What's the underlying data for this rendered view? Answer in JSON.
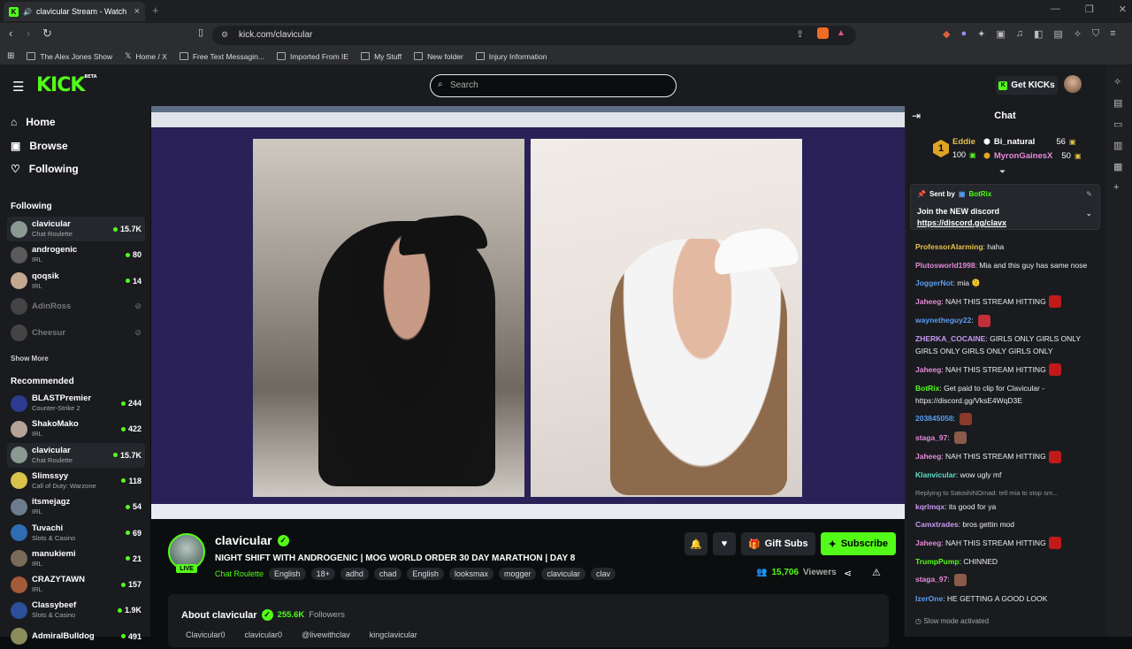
{
  "browser": {
    "tab_title": "clavicular Stream - Watch Live",
    "new_tab": "+",
    "url": "kick.com/clavicular",
    "window_controls": [
      "—",
      "❐",
      "✕"
    ],
    "bookmarks": [
      "The Alex Jones Show",
      "Home / X",
      "Free Text Messagin...",
      "Imported From IE",
      "My Stuff",
      "New folder",
      "Injury Information"
    ]
  },
  "header": {
    "logo": "KICK",
    "logo_tag": "BETA",
    "search_placeholder": "Search",
    "get_kicks": "Get KICKs"
  },
  "sidebar": {
    "nav": [
      {
        "icon": "home-icon",
        "label": "Home"
      },
      {
        "icon": "browse-icon",
        "label": "Browse"
      },
      {
        "icon": "heart-icon",
        "label": "Following"
      }
    ],
    "following_heading": "Following",
    "following": [
      {
        "name": "clavicular",
        "category": "Chat Roulette",
        "viewers": "15.7K",
        "live": true,
        "active": true,
        "color": "#8a9a93"
      },
      {
        "name": "androgenic",
        "category": "IRL",
        "viewers": "80",
        "live": true,
        "color": "#5a5a5a"
      },
      {
        "name": "qoqsik",
        "category": "IRL",
        "viewers": "14",
        "live": true,
        "color": "#c4a88f"
      },
      {
        "name": "AdinRoss",
        "category": "",
        "viewers": "",
        "live": false,
        "color": "#444"
      },
      {
        "name": "Cheesur",
        "category": "",
        "viewers": "",
        "live": false,
        "color": "#444"
      }
    ],
    "show_more": "Show More",
    "recommended_heading": "Recommended",
    "recommended": [
      {
        "name": "BLASTPremier",
        "category": "Counter-Strike 2",
        "viewers": "244",
        "color": "#2c3b8e"
      },
      {
        "name": "ShakoMako",
        "category": "IRL",
        "viewers": "422",
        "color": "#b5a397"
      },
      {
        "name": "clavicular",
        "category": "Chat Roulette",
        "viewers": "15.7K",
        "active": true,
        "color": "#8a9a93"
      },
      {
        "name": "Slimssyy",
        "category": "Call of Duty: Warzone",
        "viewers": "118",
        "color": "#d9c24a"
      },
      {
        "name": "itsmejagz",
        "category": "IRL",
        "viewers": "54",
        "color": "#6c7c8c"
      },
      {
        "name": "Tuvachi",
        "category": "Slots & Casino",
        "viewers": "69",
        "color": "#2f6db3"
      },
      {
        "name": "manukiemi",
        "category": "IRL",
        "viewers": "21",
        "color": "#7a6a5a"
      },
      {
        "name": "CRAZYTAWN",
        "category": "IRL",
        "viewers": "157",
        "color": "#a45a3a"
      },
      {
        "name": "Classybeef",
        "category": "Slots & Casino",
        "viewers": "1.9K",
        "color": "#2b4f9b"
      },
      {
        "name": "AdmiralBulldog",
        "category": "",
        "viewers": "491",
        "color": "#8c8c5c"
      }
    ]
  },
  "stream": {
    "channel": "clavicular",
    "live_label": "LIVE",
    "title": "NIGHT SHIFT WITH ANDROGENIC | MOG WORLD ORDER 30 DAY MARATHON | DAY 8",
    "category": "Chat Roulette",
    "tags": [
      "English",
      "18+",
      "adhd",
      "chad",
      "English",
      "looksmax",
      "mogger",
      "clavicular",
      "clav"
    ],
    "gift_subs": "Gift Subs",
    "subscribe": "Subscribe",
    "viewers": "15,706",
    "viewers_label": "Viewers",
    "about_title": "About clavicular",
    "followers": "255.6K",
    "followers_label": "Followers",
    "socials": [
      "Clavicular0",
      "clavicular0",
      "@livewithclav",
      "kingclavicular"
    ]
  },
  "chat": {
    "title": "Chat",
    "leaderboard": [
      {
        "name": "Eddie",
        "amount": "100",
        "rank": "1"
      },
      {
        "name": "Bi_natural",
        "amount": "56"
      },
      {
        "name": "MyronGainesX",
        "amount": "50"
      }
    ],
    "pinned": {
      "sent_by_label": "Sent by",
      "sender": "BotRix",
      "message": "Join the NEW discord",
      "link": "https://discord.gg/clavx"
    },
    "messages": [
      {
        "user": "ProfessorAlarming",
        "color": "#e7c14a",
        "text": "haha"
      },
      {
        "user": "Plutosworld1998",
        "color": "#e58ad8",
        "text": "Mia and this guy has same nose"
      },
      {
        "user": "JoggerNot",
        "color": "#5b9df0",
        "text": "mia 🫠"
      },
      {
        "user": "Jaheeg",
        "color": "#e58ad8",
        "text": "NAH THIS STREAM HITTING",
        "emote": "#c21a1a"
      },
      {
        "user": "waynetheguy22",
        "color": "#5b9df0",
        "text": "",
        "emote": "#c0303a"
      },
      {
        "user": "ZHERKA_COCAINE",
        "color": "#c89af0",
        "text": "GIRLS ONLY GIRLS ONLY GIRLS ONLY GIRLS ONLY GIRLS ONLY"
      },
      {
        "user": "Jaheeg",
        "color": "#e58ad8",
        "text": "NAH THIS STREAM HITTING",
        "emote": "#c21a1a"
      },
      {
        "user": "BotRix",
        "color": "#53fc18",
        "text": "Get paid to clip for Clavicular - https://discord.gg/VksE4WqD3E"
      },
      {
        "user": "203845058",
        "color": "#5b9df0",
        "text": "",
        "emote": "#8a3a2a"
      },
      {
        "user": "staga_97",
        "color": "#e58ad8",
        "text": "",
        "emote": "#8a5a4a"
      },
      {
        "user": "Jaheeg",
        "color": "#e58ad8",
        "text": "NAH THIS STREAM HITTING",
        "emote": "#c21a1a"
      },
      {
        "user": "Klanvicular",
        "color": "#5ae0c8",
        "text": "wow ugly mf"
      },
      {
        "user": "kqrlmqx",
        "color": "#c89af0",
        "text": "its good for ya",
        "reply": "Replying to SatoshiNOmad: tell mia to stop sm..."
      },
      {
        "user": "Camxtrades",
        "color": "#c89af0",
        "text": "bros gettin mod"
      },
      {
        "user": "Jaheeg",
        "color": "#e58ad8",
        "text": "NAH THIS STREAM HITTING",
        "emote": "#c21a1a"
      },
      {
        "user": "TrumpPump",
        "color": "#53fc18",
        "text": "CHINNED"
      },
      {
        "user": "staga_97",
        "color": "#e58ad8",
        "text": "",
        "emote": "#8a5a4a"
      },
      {
        "user": "IzerOne",
        "color": "#5b9df0",
        "text": "HE GETTING A GOOD LOOK"
      }
    ],
    "slow_mode": "Slow mode activated"
  }
}
